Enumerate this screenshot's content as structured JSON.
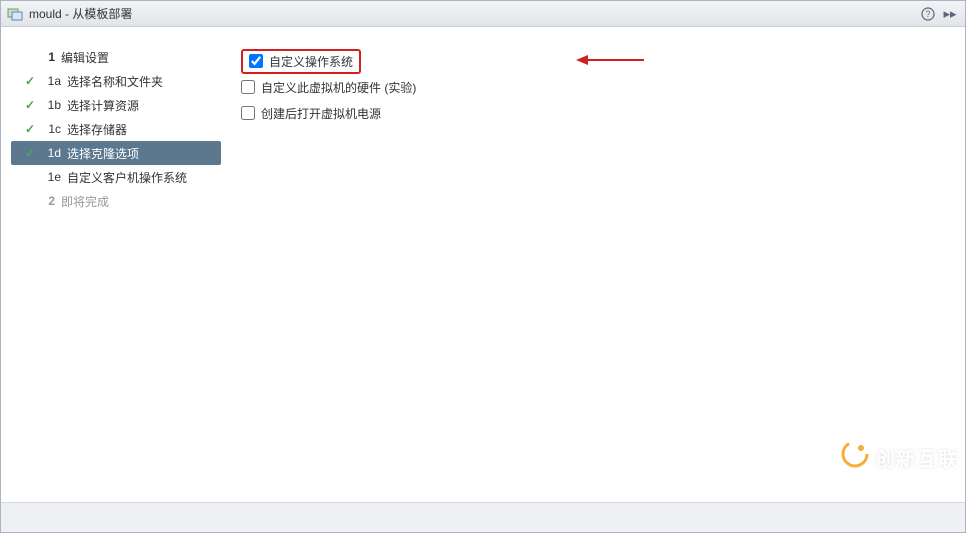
{
  "titlebar": {
    "icon_name": "vm-template-icon",
    "title": "mould - 从模板部署"
  },
  "sidebar": {
    "steps": [
      {
        "num": "1",
        "label": "编辑设置",
        "type": "main",
        "checked": false,
        "selected": false,
        "disabled": false
      },
      {
        "num": "1a",
        "label": "选择名称和文件夹",
        "type": "sub",
        "checked": true,
        "selected": false,
        "disabled": false
      },
      {
        "num": "1b",
        "label": "选择计算资源",
        "type": "sub",
        "checked": true,
        "selected": false,
        "disabled": false
      },
      {
        "num": "1c",
        "label": "选择存储器",
        "type": "sub",
        "checked": true,
        "selected": false,
        "disabled": false
      },
      {
        "num": "1d",
        "label": "选择克隆选项",
        "type": "sub",
        "checked": true,
        "selected": true,
        "disabled": false
      },
      {
        "num": "1e",
        "label": "自定义客户机操作系统",
        "type": "sub",
        "checked": false,
        "selected": false,
        "disabled": false
      },
      {
        "num": "2",
        "label": "即将完成",
        "type": "main",
        "checked": false,
        "selected": false,
        "disabled": true
      }
    ]
  },
  "content": {
    "options": [
      {
        "label": "自定义操作系统",
        "checked": true,
        "highlighted": true
      },
      {
        "label": "自定义此虚拟机的硬件 (实验)",
        "checked": false,
        "highlighted": false
      },
      {
        "label": "创建后打开虚拟机电源",
        "checked": false,
        "highlighted": false
      }
    ]
  },
  "watermark": {
    "text": "创新互联"
  }
}
